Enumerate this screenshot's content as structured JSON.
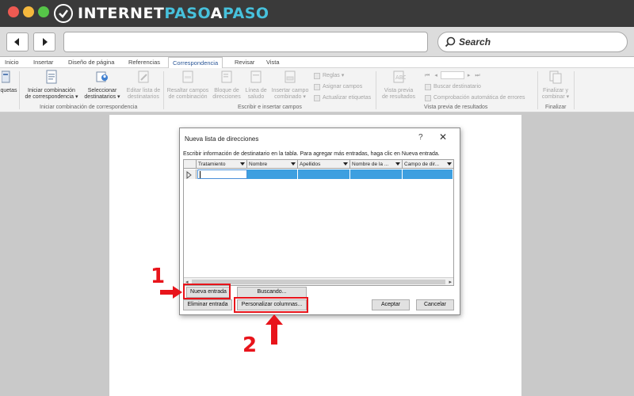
{
  "browser": {
    "logo": {
      "part1": "INTERNET",
      "part2": "PASO",
      "part3": "A",
      "part4": "PASO"
    },
    "search_label": "Search",
    "colors": {
      "accent": "#47c1dc",
      "titlebar": "#3a3a3a"
    }
  },
  "ribbon": {
    "tabs": [
      "Inicio",
      "Insertar",
      "Diseño de página",
      "Referencias",
      "Correspondencia",
      "Revisar",
      "Vista"
    ],
    "active_tab": "Correspondencia",
    "items": {
      "etiquetas": "quetas",
      "iniciar_l1": "Iniciar combinación",
      "iniciar_l2": "de correspondencia",
      "seleccionar_l1": "Seleccionar",
      "seleccionar_l2": "destinatarios",
      "editar_l1": "Editar lista de",
      "editar_l2": "destinatarios",
      "resaltar_l1": "Resaltar campos",
      "resaltar_l2": "de combinación",
      "bloque_l1": "Bloque de",
      "bloque_l2": "direcciones",
      "linea_l1": "Línea de",
      "linea_l2": "saludo",
      "insertar_l1": "Insertar campo",
      "insertar_l2": "combinado",
      "reglas": "Reglas",
      "asignar": "Asignar campos",
      "actualizar": "Actualizar etiquetas",
      "vista_l1": "Vista previa",
      "vista_l2": "de resultados",
      "buscar_dest": "Buscar destinatario",
      "comprobacion": "Comprobación automática de errores",
      "finalizar_l1": "Finalizar y",
      "finalizar_l2": "combinar"
    },
    "groups": {
      "g1": "Iniciar combinación de correspondencia",
      "g2": "Escribir e insertar campos",
      "g3": "Vista previa de resultados",
      "g4": "Finalizar"
    }
  },
  "dialog": {
    "title": "Nueva lista de direcciones",
    "help": "?",
    "close": "✕",
    "instructions": "Escribir información de destinatario en la tabla. Para agregar más entradas, haga clic en Nueva entrada.",
    "columns": [
      "Tratamiento",
      "Nombre",
      "Apellidos",
      "Nombre de la ...",
      "Campo de dir..."
    ],
    "buttons": {
      "nueva_entrada": "Nueva entrada",
      "buscando": "Buscando...",
      "eliminar_entrada": "Eliminar entrada",
      "personalizar": "Personalizar columnas...",
      "aceptar": "Aceptar",
      "cancelar": "Cancelar"
    }
  },
  "annotations": {
    "step1": "1",
    "step2": "2",
    "color": "#e8141b"
  }
}
